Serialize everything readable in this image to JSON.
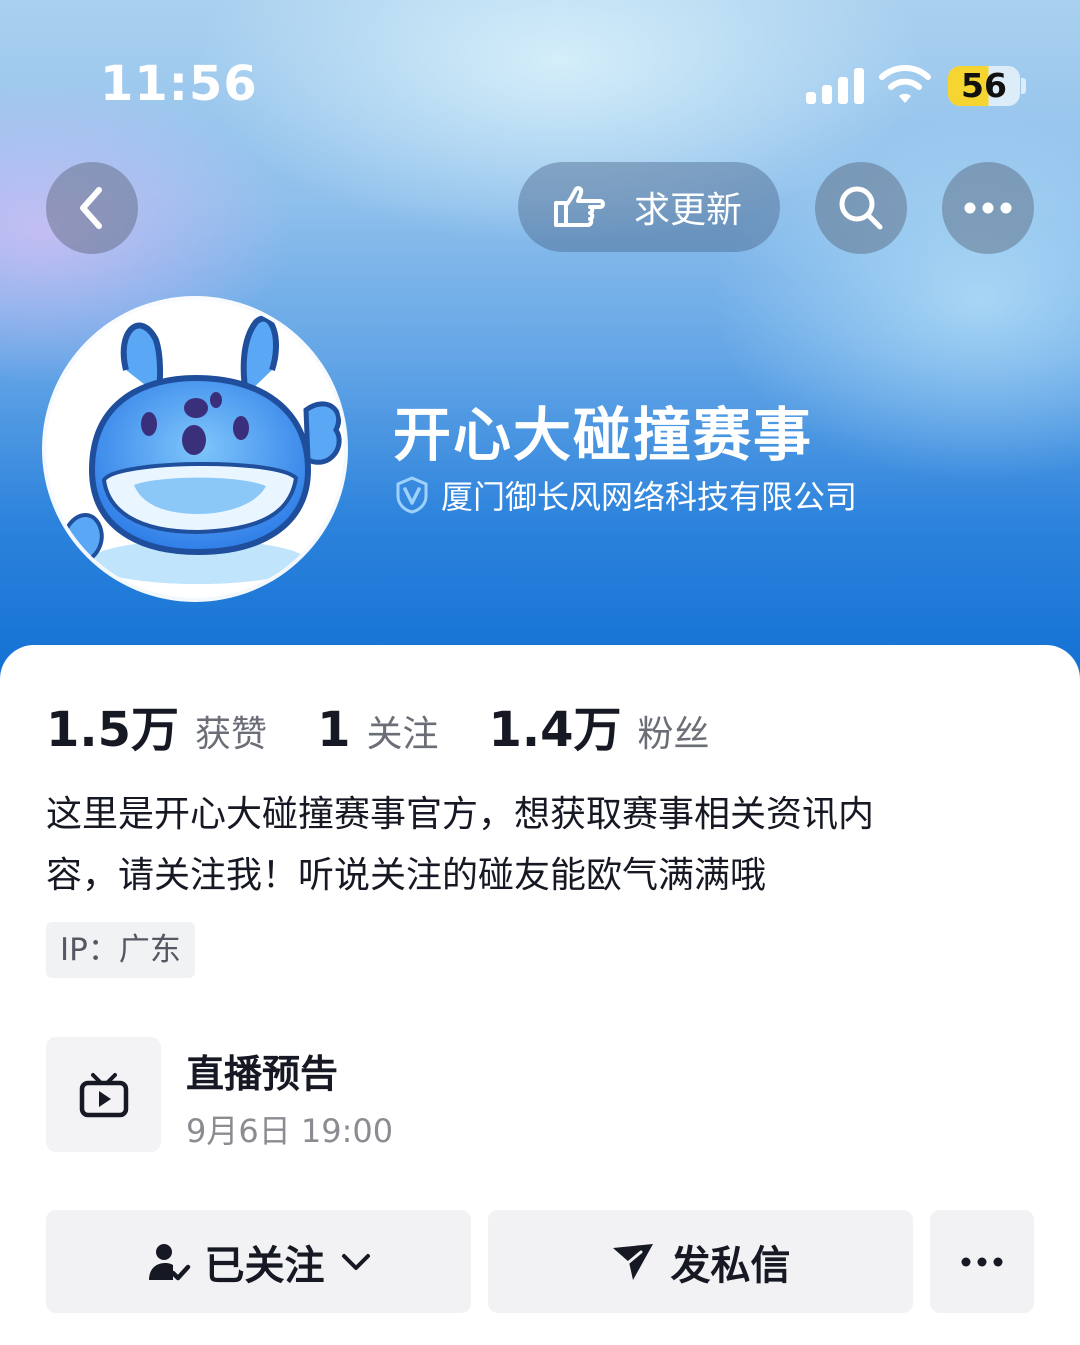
{
  "status_bar": {
    "time": "11:56",
    "battery": "56"
  },
  "nav": {
    "update_label": "求更新"
  },
  "profile": {
    "name": "开心大碰撞赛事",
    "company": "厦门御长风网络科技有限公司"
  },
  "stats": [
    {
      "value": "1.5万",
      "label": "获赞"
    },
    {
      "value": "1",
      "label": "关注"
    },
    {
      "value": "1.4万",
      "label": "粉丝"
    }
  ],
  "bio": {
    "line1": "这里是开心大碰撞赛事官方，想获取赛事相关资讯内",
    "line2": "容，请关注我！听说关注的碰友能欧气满满哦"
  },
  "ip": "IP：广东",
  "live": {
    "title": "直播预告",
    "time": "9月6日 19:00"
  },
  "actions": {
    "follow_label": "已关注",
    "message_label": "发私信"
  },
  "colors": {
    "text_primary": "#161823",
    "battery_yellow": "#f7d531",
    "header_blue": "#0f6fd3"
  }
}
